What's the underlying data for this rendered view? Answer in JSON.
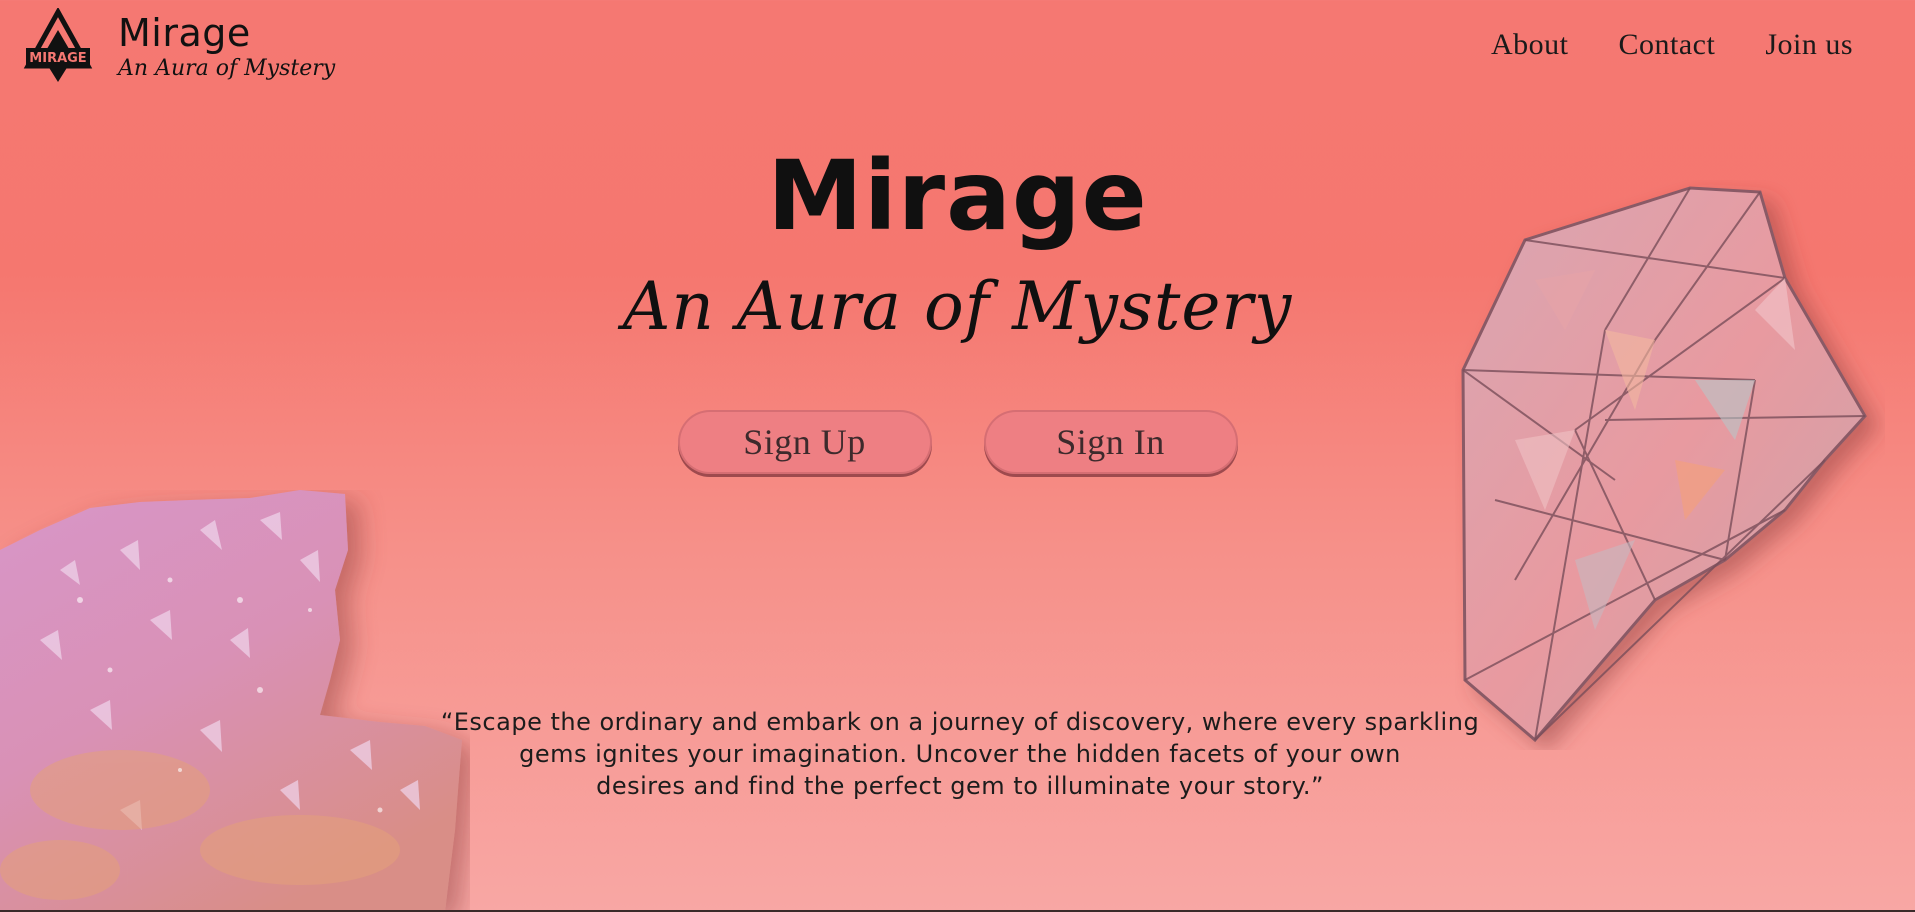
{
  "header": {
    "logo_icon": "mirage-diamond-logo-icon",
    "logo_text": "MIRAGE",
    "brand_title": "Mirage",
    "brand_subtitle": "An Aura of Mystery"
  },
  "nav": {
    "items": [
      {
        "label": "About"
      },
      {
        "label": "Contact"
      },
      {
        "label": "Join us"
      }
    ]
  },
  "hero": {
    "title": "Mirage",
    "subtitle": "An Aura of Mystery",
    "signup_label": "Sign Up",
    "signin_label": "Sign In"
  },
  "quote": {
    "line1": "“Escape the ordinary and embark on a journey of discovery, where every sparkling",
    "line2": "gems ignites your imagination. Uncover the hidden facets of your own",
    "line3": "desires and find the perfect gem to illuminate your story.”"
  },
  "images": {
    "left": "pink-crystal-cluster-image",
    "right": "faceted-pink-gem-image"
  },
  "colors": {
    "background_top": "#f57872",
    "background_bottom": "#f8a7a4",
    "button_fill": "#ee7f83",
    "text": "#101010"
  }
}
